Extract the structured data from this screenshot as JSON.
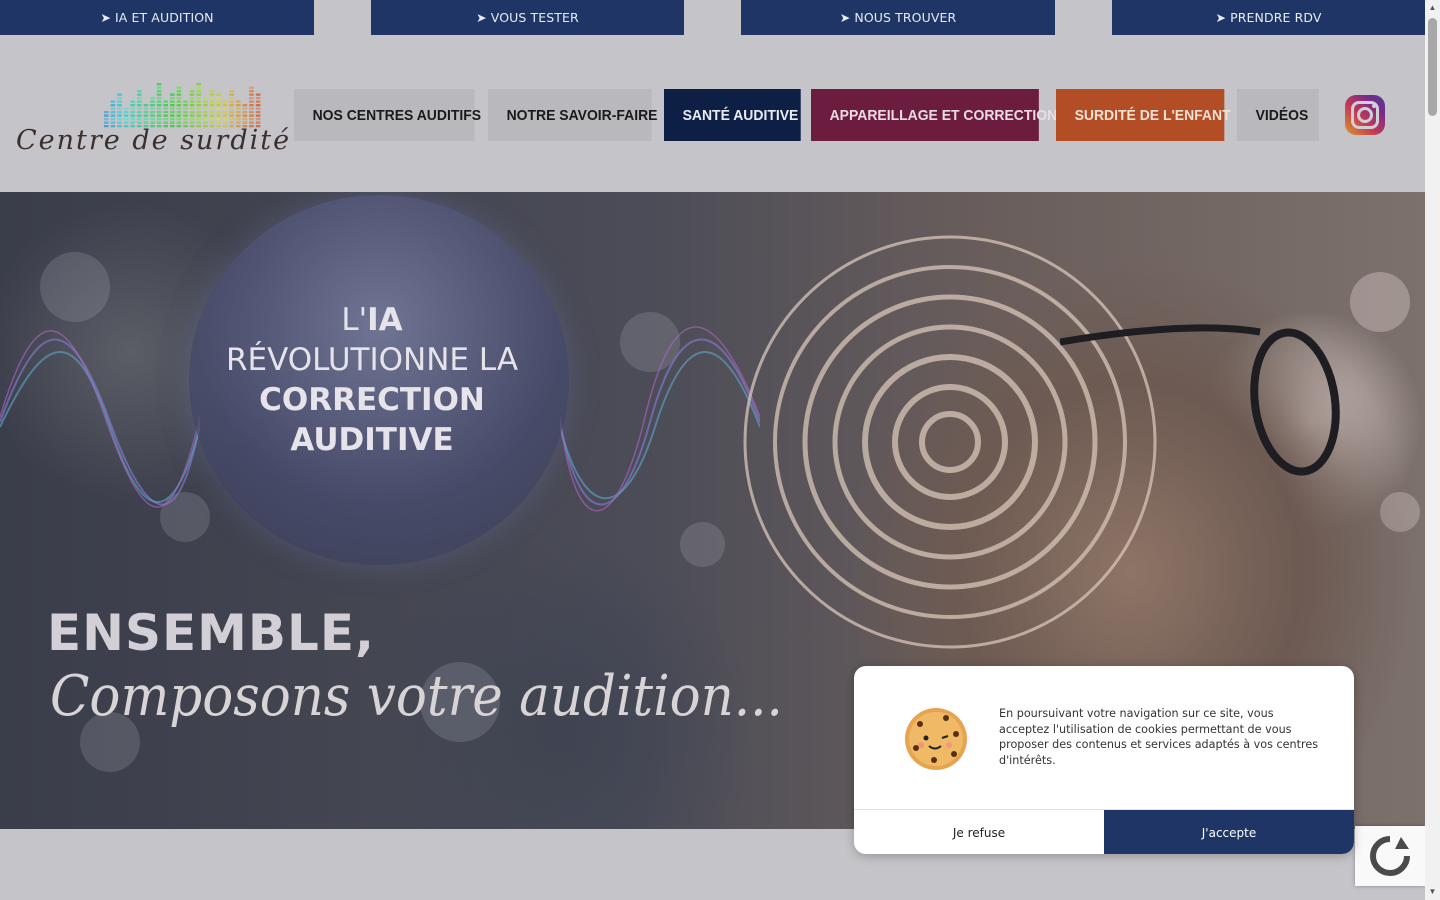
{
  "topbar": {
    "buttons": [
      {
        "label": "➤ IA ET AUDITION"
      },
      {
        "label": "➤ VOUS TESTER"
      },
      {
        "label": "➤ NOUS TROUVER"
      },
      {
        "label": "➤ PRENDRE RDV"
      }
    ],
    "color": "#1e3566"
  },
  "logo": {
    "text": "Centre de surdité"
  },
  "nav": {
    "items": [
      {
        "label": "NOS CENTRES AUDITIFS",
        "bg": "#b9b9bd",
        "fg": "#1a1a1a"
      },
      {
        "label": "NOTRE SAVOIR-FAIRE",
        "bg": "#b9b9bd",
        "fg": "#1a1a1a"
      },
      {
        "label": "SANTÉ AUDITIVE",
        "bg": "#0e1f45",
        "fg": "#e9ecf5"
      },
      {
        "label": "APPAREILLAGE ET CORRECTION",
        "bg": "#6b1c3f",
        "fg": "#e9dde3"
      },
      {
        "label": "SURDITÉ DE L'ENFANT",
        "bg": "#b24d25",
        "fg": "#f3e1d6"
      },
      {
        "label": "VIDÉOS",
        "bg": "#b9b9bd",
        "fg": "#1a1a1a"
      }
    ]
  },
  "social": {
    "icon": "instagram-icon"
  },
  "hero": {
    "bubble": {
      "line1_a": "L'",
      "line1_b": "IA",
      "line2": "RÉVOLUTIONNE LA",
      "line3": "CORRECTION",
      "line4": "AUDITIVE"
    },
    "headline": "ENSEMBLE,",
    "tagline": "Composons votre audition..."
  },
  "cookie": {
    "text": "En poursuivant votre navigation sur ce site, vous acceptez l'utilisation de cookies permettant de vous proposer des contenus et services adaptés à vos centres d'intérêts.",
    "refuse_label": "Je refuse",
    "accept_label": "J'accepte",
    "icon": "cookie-icon"
  }
}
